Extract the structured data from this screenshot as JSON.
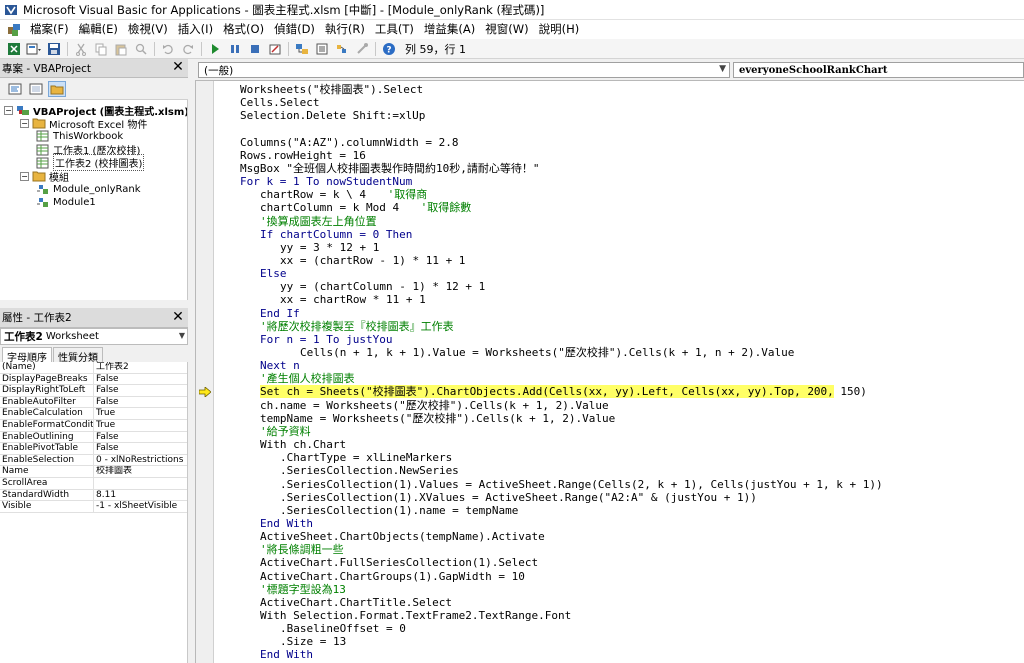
{
  "window": {
    "title": "Microsoft Visual Basic for Applications - 圖表主程式.xlsm [中斷] - [Module_onlyRank (程式碼)]"
  },
  "menu": [
    "檔案(F)",
    "編輯(E)",
    "檢視(V)",
    "插入(I)",
    "格式(O)",
    "偵錯(D)",
    "執行(R)",
    "工具(T)",
    "增益集(A)",
    "視窗(W)",
    "說明(H)"
  ],
  "toolbar": {
    "position": "列 59，行 1"
  },
  "project": {
    "title": "專案 - VBAProject",
    "nodes": [
      {
        "label": "VBAProject (圖表主程式.xlsm)",
        "indent": 0
      },
      {
        "label": "Microsoft Excel 物件",
        "indent": 1
      },
      {
        "label": "ThisWorkbook",
        "indent": 2
      },
      {
        "label": "工作表1 (歷次校排)",
        "indent": 2
      },
      {
        "label": "工作表2 (校排圖表)",
        "indent": 2
      },
      {
        "label": "模組",
        "indent": 1
      },
      {
        "label": "Module_onlyRank",
        "indent": 2
      },
      {
        "label": "Module1",
        "indent": 2
      }
    ]
  },
  "properties": {
    "title": "屬性 - 工作表2",
    "object": "工作表2",
    "object_type": "Worksheet",
    "tabs": [
      "字母順序",
      "性質分類"
    ],
    "rows": [
      {
        "name": "(Name)",
        "value": "工作表2"
      },
      {
        "name": "DisplayPageBreaks",
        "value": "False"
      },
      {
        "name": "DisplayRightToLeft",
        "value": "False"
      },
      {
        "name": "EnableAutoFilter",
        "value": "False"
      },
      {
        "name": "EnableCalculation",
        "value": "True"
      },
      {
        "name": "EnableFormatConditions",
        "value": "True"
      },
      {
        "name": "EnableOutlining",
        "value": "False"
      },
      {
        "name": "EnablePivotTable",
        "value": "False"
      },
      {
        "name": "EnableSelection",
        "value": "0 - xlNoRestrictions"
      },
      {
        "name": "Name",
        "value": "校排圖表"
      },
      {
        "name": "ScrollArea",
        "value": ""
      },
      {
        "name": "StandardWidth",
        "value": "8.11"
      },
      {
        "name": "Visible",
        "value": "-1 - xlSheetVisible"
      }
    ]
  },
  "code": {
    "object_combo": "(一般)",
    "proc_combo": "everyoneSchoolRankChart",
    "lines": [
      {
        "text": "Worksheets(\"校排圖表\").Select",
        "indent": 0,
        "type": "n"
      },
      {
        "text": "Cells.Select",
        "indent": 0,
        "type": "n"
      },
      {
        "text": "Selection.Delete Shift:=xlUp",
        "indent": 0,
        "type": "n"
      },
      {
        "text": "",
        "indent": 0,
        "type": "n"
      },
      {
        "text": "Columns(\"A:AZ\").columnWidth = 2.8",
        "indent": 0,
        "type": "n"
      },
      {
        "text": "Rows.rowHeight = 16",
        "indent": 0,
        "type": "n"
      },
      {
        "text": "MsgBox \"全班個人校排圖表製作時間約10秒,請耐心等待！\"",
        "indent": 0,
        "type": "n"
      },
      {
        "text": "For k = 1 To nowStudentNum",
        "indent": 0,
        "type": "kw"
      },
      {
        "text": "chartRow = k \\ 4",
        "indent": 1,
        "type": "n",
        "comment": "'取得商"
      },
      {
        "text": "chartColumn = k Mod 4",
        "indent": 1,
        "type": "n",
        "comment": "'取得餘數"
      },
      {
        "text": "'換算成圖表左上角位置",
        "indent": 1,
        "type": "cm"
      },
      {
        "text": "If chartColumn = 0 Then",
        "indent": 1,
        "type": "kw"
      },
      {
        "text": "yy = 3 * 12 + 1",
        "indent": 2,
        "type": "n"
      },
      {
        "text": "xx = (chartRow - 1) * 11 + 1",
        "indent": 2,
        "type": "n"
      },
      {
        "text": "Else",
        "indent": 1,
        "type": "kw"
      },
      {
        "text": "yy = (chartColumn - 1) * 12 + 1",
        "indent": 2,
        "type": "n"
      },
      {
        "text": "xx = chartRow * 11 + 1",
        "indent": 2,
        "type": "n"
      },
      {
        "text": "End If",
        "indent": 1,
        "type": "kw"
      },
      {
        "text": "'將歷次校排複製至『校排圖表』工作表",
        "indent": 1,
        "type": "cm"
      },
      {
        "text": "For n = 1 To justYou",
        "indent": 1,
        "type": "kw"
      },
      {
        "text": "Cells(n + 1, k + 1).Value = Worksheets(\"歷次校排\").Cells(k + 1, n + 2).Value",
        "indent": 3,
        "type": "n"
      },
      {
        "text": "Next n",
        "indent": 1,
        "type": "kw"
      },
      {
        "text": "'產生個人校排圖表",
        "indent": 1,
        "type": "cm"
      },
      {
        "text": "Set ch = Sheets(\"校排圖表\").ChartObjects.Add(Cells(xx, yy).Left, Cells(xx, yy).Top, 200, 150)",
        "indent": 1,
        "type": "n",
        "highlight": true
      },
      {
        "text": "ch.name = Worksheets(\"歷次校排\").Cells(k + 1, 2).Value",
        "indent": 1,
        "type": "n"
      },
      {
        "text": "tempName = Worksheets(\"歷次校排\").Cells(k + 1, 2).Value",
        "indent": 1,
        "type": "n"
      },
      {
        "text": "'給予資料",
        "indent": 1,
        "type": "cm"
      },
      {
        "text": "With ch.Chart",
        "indent": 1,
        "type": "n"
      },
      {
        "text": ".ChartType = xlLineMarkers",
        "indent": 2,
        "type": "n"
      },
      {
        "text": ".SeriesCollection.NewSeries",
        "indent": 2,
        "type": "n"
      },
      {
        "text": ".SeriesCollection(1).Values = ActiveSheet.Range(Cells(2, k + 1), Cells(justYou + 1, k + 1))",
        "indent": 2,
        "type": "n"
      },
      {
        "text": ".SeriesCollection(1).XValues = ActiveSheet.Range(\"A2:A\" & (justYou + 1))",
        "indent": 2,
        "type": "n"
      },
      {
        "text": ".SeriesCollection(1).name = tempName",
        "indent": 2,
        "type": "n"
      },
      {
        "text": "End With",
        "indent": 1,
        "type": "kw"
      },
      {
        "text": "ActiveSheet.ChartObjects(tempName).Activate",
        "indent": 1,
        "type": "n"
      },
      {
        "text": "'將長條調粗一些",
        "indent": 1,
        "type": "cm"
      },
      {
        "text": "ActiveChart.FullSeriesCollection(1).Select",
        "indent": 1,
        "type": "n"
      },
      {
        "text": "ActiveChart.ChartGroups(1).GapWidth = 10",
        "indent": 1,
        "type": "n"
      },
      {
        "text": "'標題字型設為13",
        "indent": 1,
        "type": "cm"
      },
      {
        "text": "ActiveChart.ChartTitle.Select",
        "indent": 1,
        "type": "n"
      },
      {
        "text": "With Selection.Format.TextFrame2.TextRange.Font",
        "indent": 1,
        "type": "n"
      },
      {
        "text": ".BaselineOffset = 0",
        "indent": 2,
        "type": "n"
      },
      {
        "text": ".Size = 13",
        "indent": 2,
        "type": "n"
      },
      {
        "text": "End With",
        "indent": 1,
        "type": "kw"
      }
    ]
  }
}
